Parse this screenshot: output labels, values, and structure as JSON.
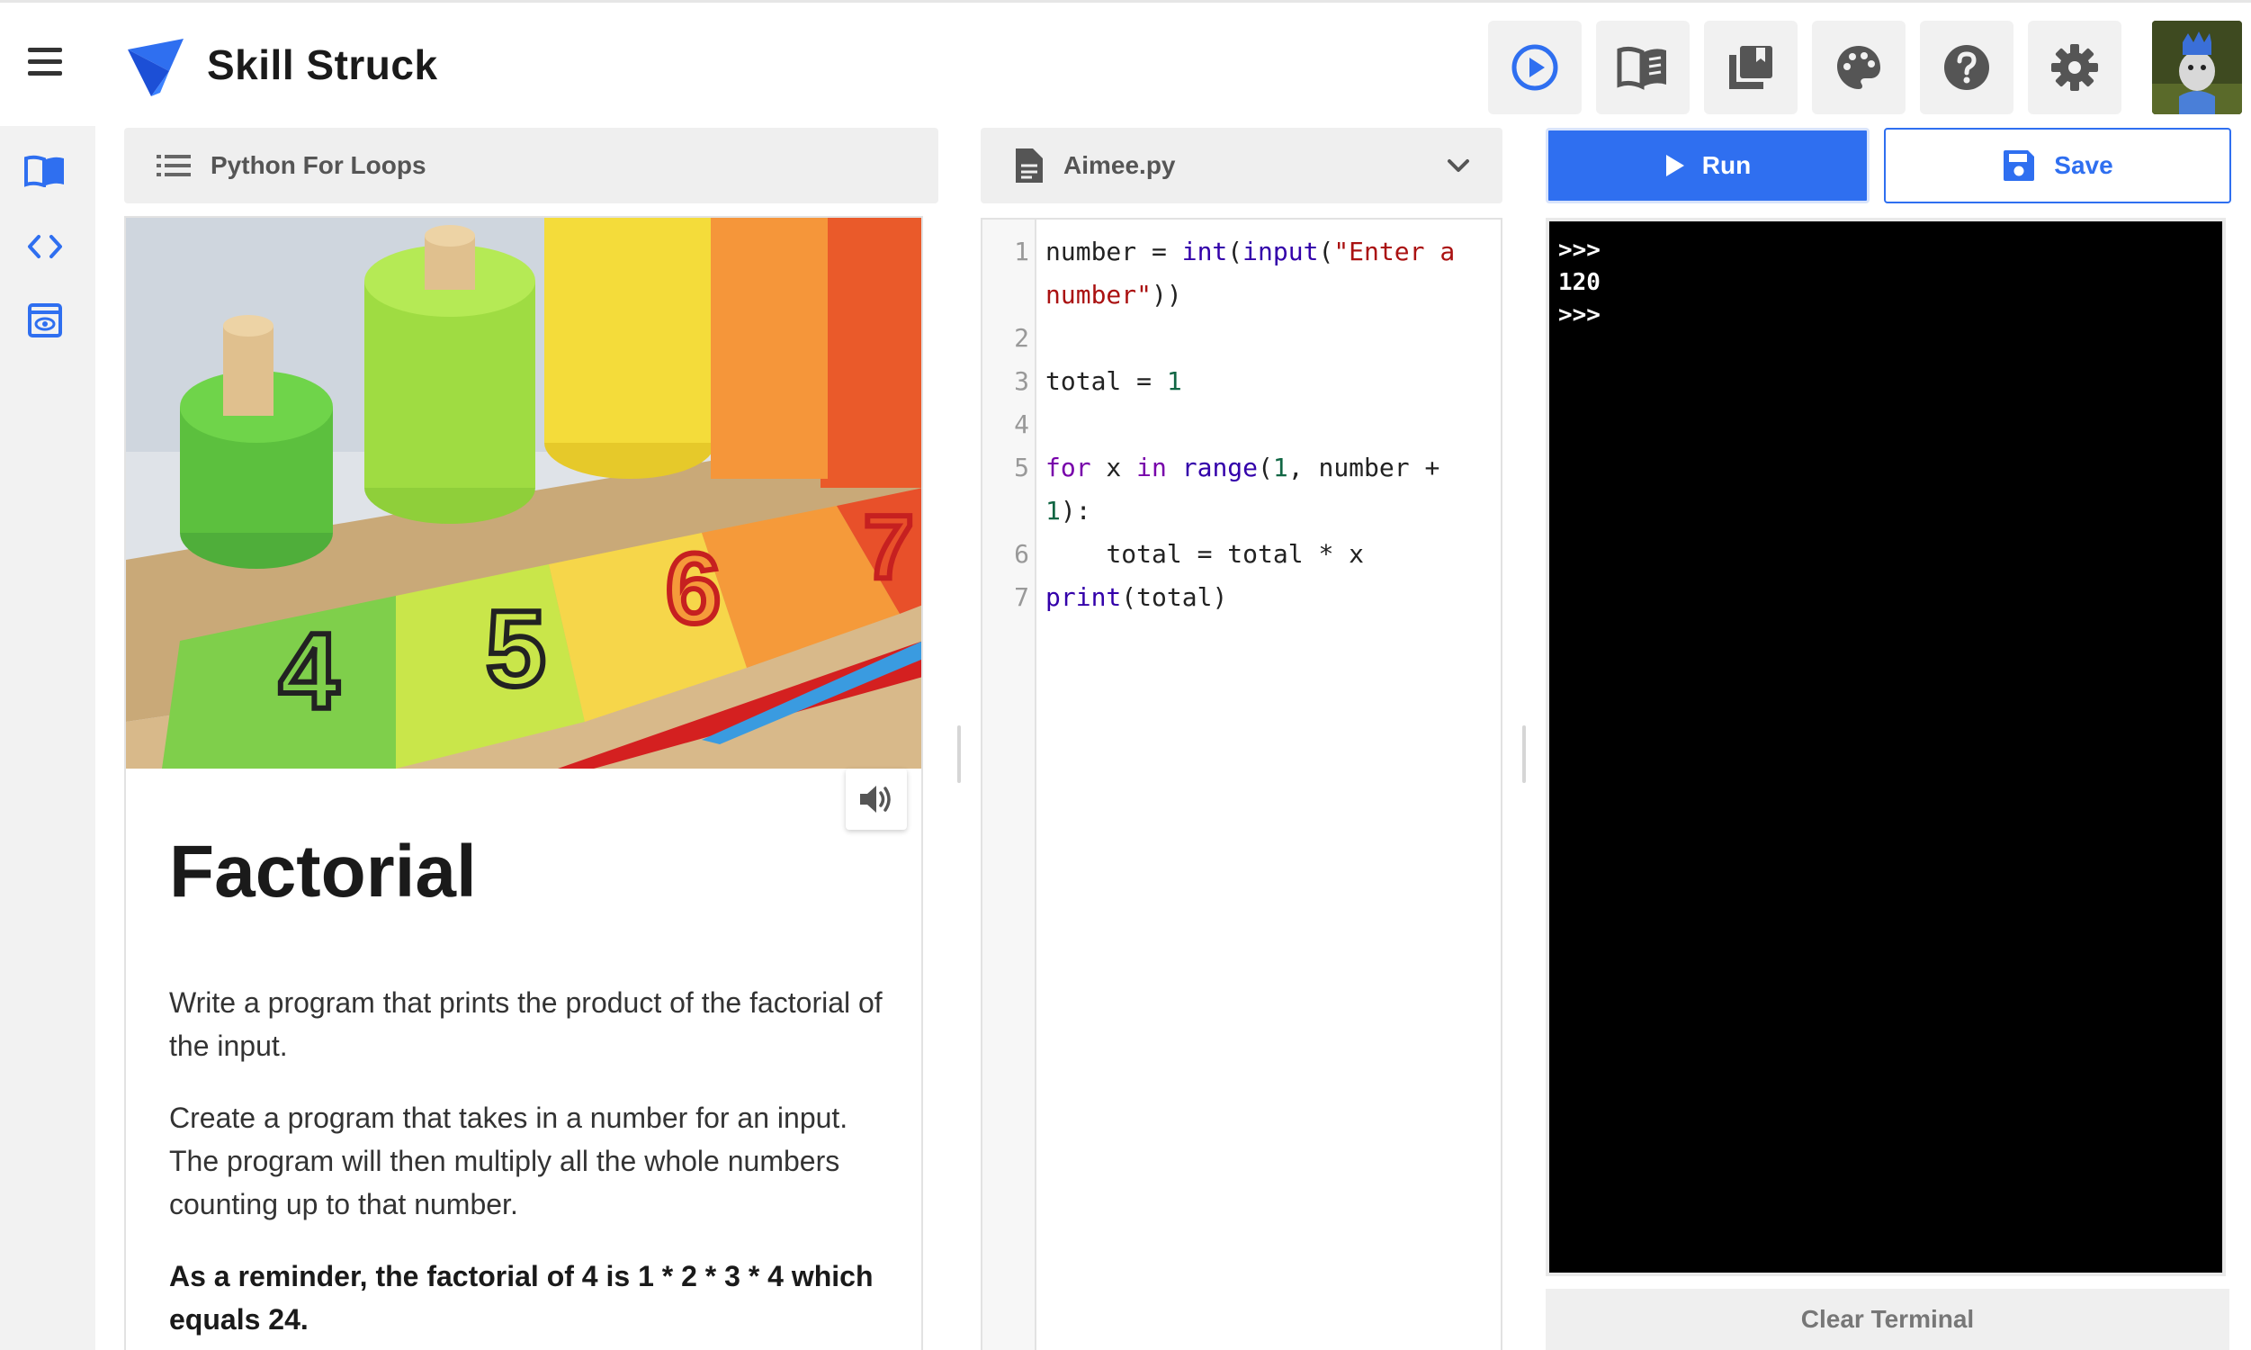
{
  "app": {
    "brand": "Skill Struck"
  },
  "toolbar": {
    "buttons": [
      {
        "name": "play-tutorial-icon"
      },
      {
        "name": "book-icon"
      },
      {
        "name": "library-icon"
      },
      {
        "name": "palette-icon"
      },
      {
        "name": "help-icon"
      },
      {
        "name": "gear-icon"
      }
    ]
  },
  "rail": {
    "items": [
      "lesson-icon",
      "code-icon",
      "preview-icon"
    ]
  },
  "lesson": {
    "header": "Python For Loops",
    "heading": "Factorial",
    "paragraphs": [
      "Write a program that prints the product of the factorial of the input.",
      "Create a program that takes in a number for an input. The program will then multiply all the whole numbers counting up to that number."
    ],
    "reminder": "As a reminder, the factorial of 4 is 1 * 2 * 3 * 4 which equals 24."
  },
  "editor": {
    "filename": "Aimee.py",
    "line_numbers": [
      "1",
      "2",
      "3",
      "4",
      "5",
      "6",
      "7"
    ],
    "lines": [
      "number = int(input(\"Enter a number\"))",
      "",
      "total = 1",
      "",
      "for x in range(1, number + 1):",
      "    total = total * x",
      "print(total)"
    ]
  },
  "actions": {
    "run": "Run",
    "save": "Save",
    "clear": "Clear Terminal"
  },
  "terminal": {
    "lines": [
      ">>>",
      "120",
      ">>>"
    ]
  },
  "colors": {
    "accent": "#2f6ff0",
    "terminal_bg": "#000000",
    "panel_bg": "#efefef"
  }
}
